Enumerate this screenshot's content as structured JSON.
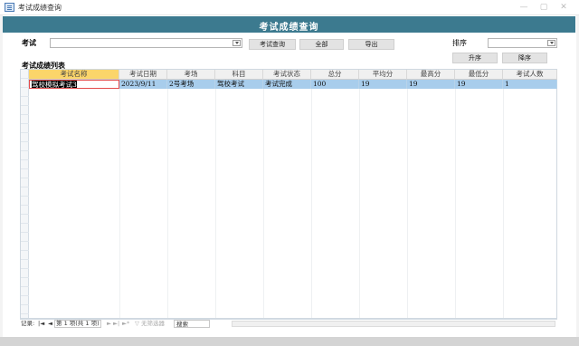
{
  "window": {
    "title": "考试成绩查询"
  },
  "header": {
    "title": "考试成绩查询"
  },
  "filters": {
    "exam_label": "考试",
    "exam_value": "",
    "sort_label": "排序",
    "sort_value": ""
  },
  "buttons": {
    "query": "考试查询",
    "all": "全部",
    "export": "导出",
    "asc": "升序",
    "desc": "降序"
  },
  "list": {
    "title": "考试成绩列表"
  },
  "table": {
    "columns": [
      "考试名称",
      "考试日期",
      "考场",
      "科目",
      "考试状态",
      "总分",
      "平均分",
      "最高分",
      "最低分",
      "考试人数"
    ],
    "rows": [
      [
        "驾校模拟考试3",
        "2023/9/11",
        "2号考场",
        "驾校考试",
        "考试完成",
        "100",
        "19",
        "19",
        "19",
        "1"
      ]
    ]
  },
  "navigation": {
    "record_label": "记录:",
    "first": "|◄",
    "prev": "◄",
    "position": "第 1 项(共 1 项)",
    "next": "►",
    "last": "►|",
    "new": "►*",
    "filter_label": "无筛选器",
    "search_label": "搜索"
  }
}
